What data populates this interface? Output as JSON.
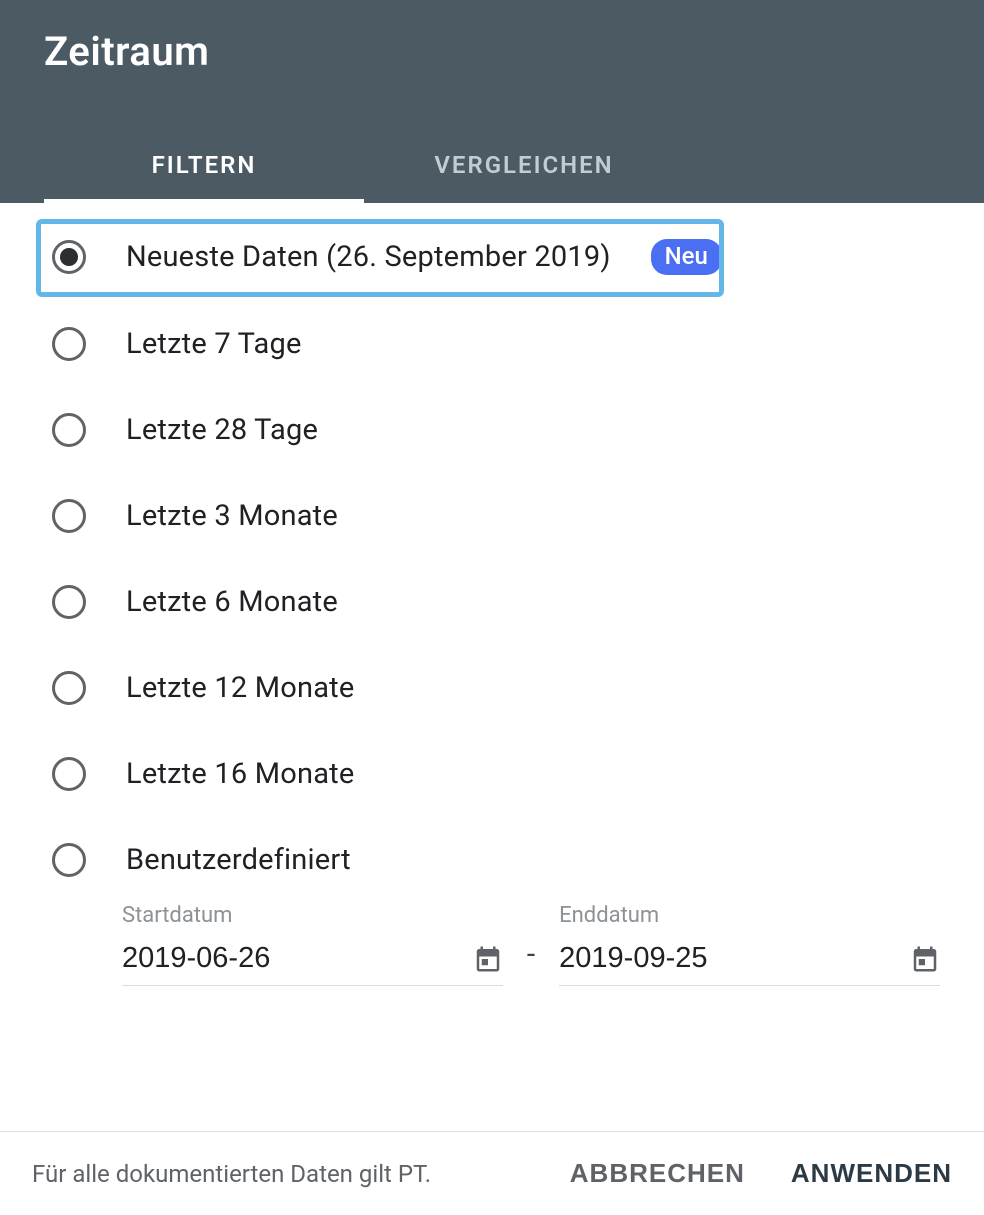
{
  "header": {
    "title": "Zeitraum"
  },
  "tabs": [
    {
      "label": "FILTERN",
      "active": true
    },
    {
      "label": "VERGLEICHEN",
      "active": false
    }
  ],
  "options": [
    {
      "label": "Neueste Daten (26. September 2019)",
      "checked": true,
      "badge": "Neu",
      "highlighted": true
    },
    {
      "label": "Letzte 7 Tage",
      "checked": false
    },
    {
      "label": "Letzte 28 Tage",
      "checked": false
    },
    {
      "label": "Letzte 3 Monate",
      "checked": false
    },
    {
      "label": "Letzte 6 Monate",
      "checked": false
    },
    {
      "label": "Letzte 12 Monate",
      "checked": false
    },
    {
      "label": "Letzte 16 Monate",
      "checked": false
    },
    {
      "label": "Benutzerdefiniert",
      "checked": false
    }
  ],
  "custom_range": {
    "start_label": "Startdatum",
    "start_value": "2019-06-26",
    "end_label": "Enddatum",
    "end_value": "2019-09-25",
    "separator": "-"
  },
  "footer": {
    "note": "Für alle dokumentierten Daten gilt PT.",
    "cancel": "ABBRECHEN",
    "apply": "ANWENDEN"
  }
}
